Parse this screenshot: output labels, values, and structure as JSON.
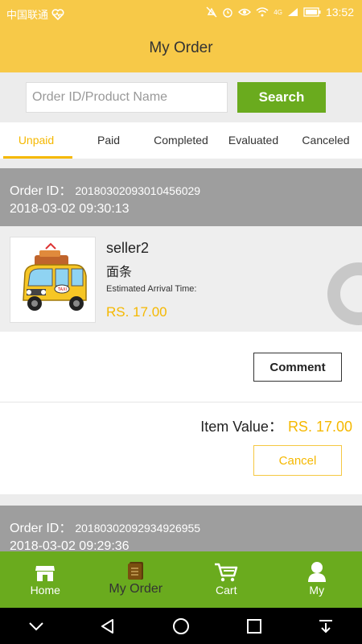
{
  "status_bar": {
    "carrier": "中国联通",
    "time": "13:52",
    "network": "4G"
  },
  "header": {
    "title": "My Order"
  },
  "search": {
    "placeholder": "Order ID/Product Name",
    "value": "",
    "button_label": "Search"
  },
  "tabs": [
    {
      "label": "Unpaid",
      "active": true
    },
    {
      "label": "Paid"
    },
    {
      "label": "Completed"
    },
    {
      "label": "Evaluated"
    },
    {
      "label": "Canceled"
    }
  ],
  "orders": [
    {
      "id_label": "Order ID：",
      "id": "20180302093010456029",
      "date": "2018-03-02 09:30:13",
      "seller": "seller2",
      "product_name": "面条",
      "eta_label": "Estimated Arrival Time:",
      "price": "RS. 17.00",
      "comment_label": "Comment",
      "item_value_label": "Item Value：",
      "item_value": "RS. 17.00",
      "cancel_label": "Cancel"
    },
    {
      "id_label": "Order ID：",
      "id": "20180302092934926955",
      "date": "2018-03-02 09:29:36"
    }
  ],
  "bottom_nav": [
    {
      "label": "Home",
      "icon": "store-icon"
    },
    {
      "label": "My Order",
      "icon": "order-book-icon",
      "active": true
    },
    {
      "label": "Cart",
      "icon": "cart-icon"
    },
    {
      "label": "My",
      "icon": "user-icon"
    }
  ],
  "colors": {
    "brand_yellow": "#f7c948",
    "accent_gold": "#f5b800",
    "nav_green": "#6aab1e",
    "header_gray": "#9e9e9e"
  }
}
